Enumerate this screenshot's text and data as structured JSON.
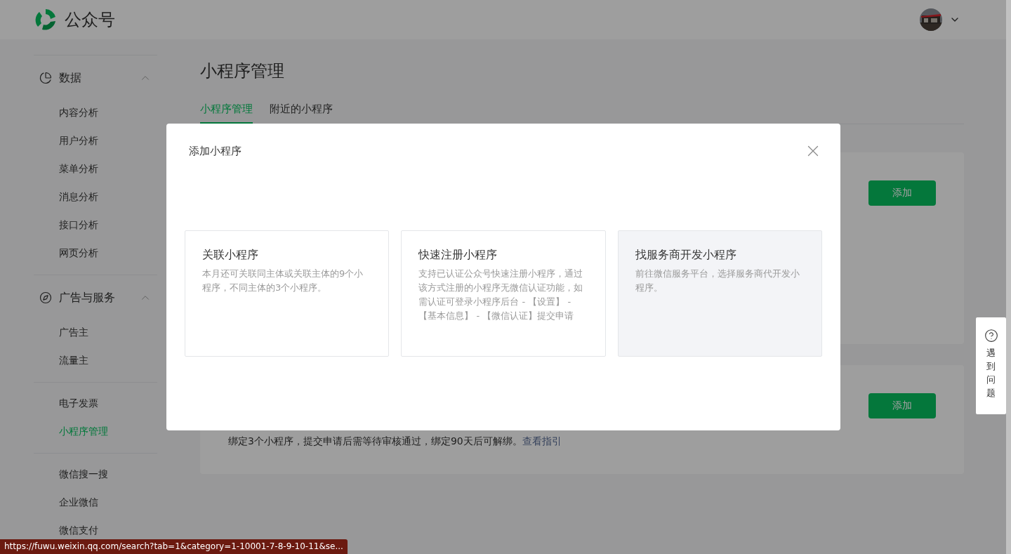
{
  "header": {
    "logo_text": "公众号"
  },
  "sidebar": {
    "sections": [
      {
        "title": "数据",
        "expanded": true,
        "items": [
          {
            "label": "内容分析",
            "selected": false
          },
          {
            "label": "用户分析",
            "selected": false
          },
          {
            "label": "菜单分析",
            "selected": false
          },
          {
            "label": "消息分析",
            "selected": false
          },
          {
            "label": "接口分析",
            "selected": false
          },
          {
            "label": "网页分析",
            "selected": false
          }
        ]
      },
      {
        "title": "广告与服务",
        "expanded": true,
        "items": [
          {
            "label": "广告主",
            "selected": false
          },
          {
            "label": "流量主",
            "selected": false
          }
        ]
      },
      {
        "items": [
          {
            "label": "电子发票",
            "selected": false
          },
          {
            "label": "小程序管理",
            "selected": true
          }
        ]
      },
      {
        "items": [
          {
            "label": "微信搜一搜",
            "selected": false
          },
          {
            "label": "企业微信",
            "selected": false
          },
          {
            "label": "微信支付",
            "selected": false
          }
        ]
      }
    ]
  },
  "page": {
    "title": "小程序管理",
    "tabs": [
      {
        "label": "小程序管理",
        "selected": true
      },
      {
        "label": "附近的小程序",
        "selected": false
      }
    ],
    "cards": [
      {
        "button": "添加"
      },
      {
        "note": "绑定3个小程序，提交申请后需等待审核通过，绑定90天后可解绑。",
        "link": "查看指引",
        "button": "添加"
      }
    ]
  },
  "modal": {
    "title": "添加小程序",
    "options": [
      {
        "title": "关联小程序",
        "description": "本月还可关联同主体或关联主体的9个小程序，不同主体的3个小程序。",
        "highlighted": false
      },
      {
        "title": "快速注册小程序",
        "description": "支持已认证公众号快速注册小程序，通过该方式注册的小程序无微信认证功能，如需认证可登录小程序后台 - 【设置】 - 【基本信息】 - 【微信认证】提交申请",
        "highlighted": false
      },
      {
        "title": "找服务商开发小程序",
        "description": "前往微信服务平台，选择服务商代开发小程序。",
        "highlighted": true
      }
    ]
  },
  "help_widget": {
    "label": "遇到问题"
  },
  "status_bar": {
    "url": "https://fuwu.weixin.qq.com/search?tab=1&category=1-10001-7-8-9-10-11&se..."
  }
}
